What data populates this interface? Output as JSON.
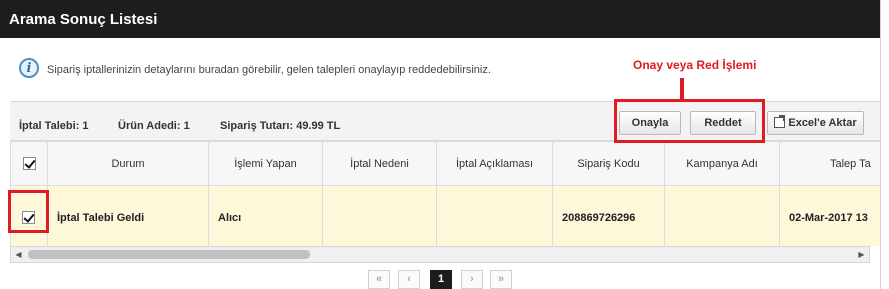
{
  "window": {
    "title": "Arama Sonuç Listesi"
  },
  "info": {
    "icon": "info-icon",
    "glyph": "i",
    "text": "Sipariş iptallerinizin detaylarını buradan görebilir, gelen talepleri onaylayıp reddedebilirsiniz."
  },
  "annotation": {
    "label": "Onay veya Red İşlemi",
    "color": "#e01b24"
  },
  "toolbar": {
    "iptal_talebi": "İptal Talebi: 1",
    "urun_adedi": "Ürün Adedi: 1",
    "siparis_tutari": "Sipariş Tutarı: 49.99 TL",
    "approve_label": "Onayla",
    "reject_label": "Reddet",
    "excel_label": "Excel'e Aktar"
  },
  "table": {
    "columns": [
      "Durum",
      "İşlemi Yapan",
      "İptal Nedeni",
      "İptal Açıklaması",
      "Sipariş Kodu",
      "Kampanya Adı",
      "Talep Ta"
    ],
    "rows": [
      {
        "selected": true,
        "durum": "İptal Talebi Geldi",
        "islemi_yapan": "Alıcı",
        "iptal_nedeni": "",
        "iptal_aciklamasi": "",
        "siparis_kodu": "208869726296",
        "kampanya_adi": "",
        "talep_tarihi": "02-Mar-2017 13"
      }
    ],
    "header_checkbox_checked": true
  },
  "scrollbar": {
    "left_arrow": "◀",
    "right_arrow": "▶"
  },
  "pager": {
    "first": "«",
    "prev": "‹",
    "current": "1",
    "next": "›",
    "last": "»"
  },
  "colors": {
    "titlebar": "#1d1d1d",
    "selected_row": "#fcf8d9",
    "highlight": "#e01b24"
  }
}
